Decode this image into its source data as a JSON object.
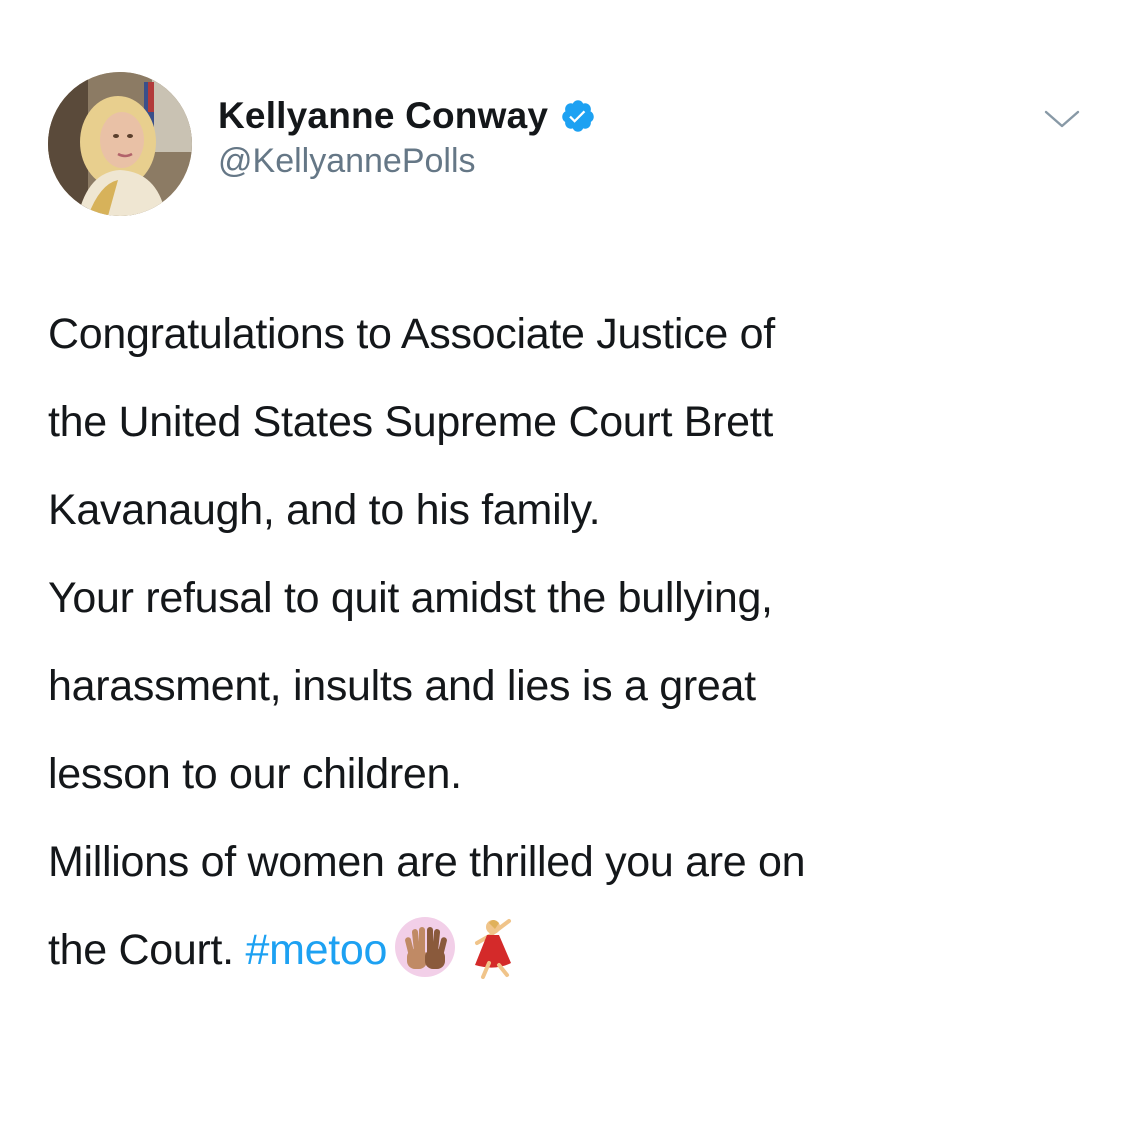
{
  "tweet": {
    "author": {
      "display_name": "Kellyanne Conway",
      "handle": "@KellyannePolls",
      "verified": true,
      "avatar_icon": "profile-photo"
    },
    "menu_icon": "chevron-down-icon",
    "paragraphs": [
      {
        "lines": [
          "Congratulations to Associate Justice of",
          "the United States Supreme Court Brett",
          "Kavanaugh, and to his family."
        ]
      },
      {
        "lines": [
          "Your refusal to quit amidst the bullying,",
          "harassment, insults and lies is a great",
          "lesson to our children."
        ]
      },
      {
        "lines": [
          "Millions of women are thrilled you are on"
        ],
        "last_line_prefix": "the Court. ",
        "hashtag": "#metoo",
        "emojis": [
          "raised-hands-emoji",
          "dancer-emoji"
        ]
      }
    ],
    "colors": {
      "text": "#14171a",
      "secondary": "#657786",
      "link": "#1da1f2",
      "verified": "#1da1f2"
    }
  }
}
